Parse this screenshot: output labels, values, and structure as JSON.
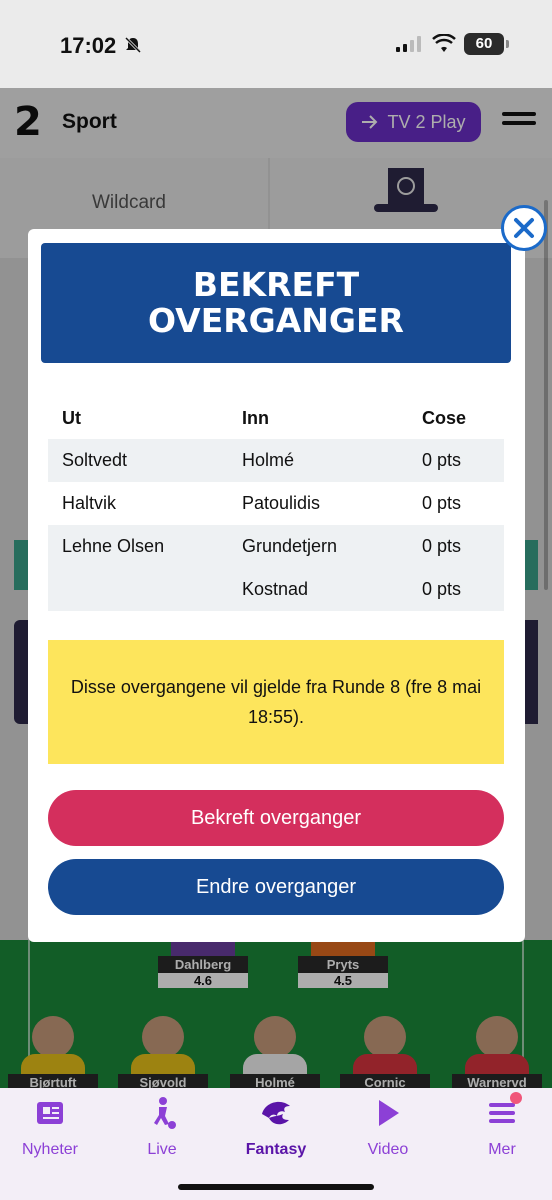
{
  "status_bar": {
    "time": "17:02",
    "battery": "60"
  },
  "header": {
    "brand_number": "2",
    "brand_name": "Sport",
    "play_button": "TV 2 Play"
  },
  "background": {
    "wildcard_label": "Wildcard",
    "pitch_players": [
      {
        "name": "Dahlberg",
        "value": "4.6"
      },
      {
        "name": "Pryts",
        "value": "4.5"
      },
      {
        "name": "Bjørtuft"
      },
      {
        "name": "Sjøvold"
      },
      {
        "name": "Holmé"
      },
      {
        "name": "Cornic"
      },
      {
        "name": "Warnervd"
      }
    ]
  },
  "modal": {
    "title": "BEKREFT OVERGANGER",
    "columns": [
      "Ut",
      "Inn",
      "Cose"
    ],
    "rows": [
      {
        "out": "Soltvedt",
        "in": "Holmé",
        "cost": "0 pts"
      },
      {
        "out": "Haltvik",
        "in": "Patoulidis",
        "cost": "0 pts"
      },
      {
        "out": "Lehne Olsen",
        "in": "Grundetjern",
        "cost": "0 pts"
      },
      {
        "out": "",
        "in": "Kostnad",
        "cost": "0 pts"
      }
    ],
    "notice": "Disse overgangene vil gjelde fra Runde 8 (fre 8 mai 18:55).",
    "confirm_button": "Bekreft overganger",
    "edit_button": "Endre overganger"
  },
  "tabbar": {
    "items": [
      {
        "label": "Nyheter",
        "icon": "newspaper-icon"
      },
      {
        "label": "Live",
        "icon": "football-player-icon"
      },
      {
        "label": "Fantasy",
        "icon": "fantasy-lion-icon",
        "active": true
      },
      {
        "label": "Video",
        "icon": "play-icon"
      },
      {
        "label": "Mer",
        "icon": "menu-icon"
      }
    ]
  },
  "colors": {
    "accent_purple": "#6b2fc7",
    "modal_blue": "#174a92",
    "confirm_red": "#d42f5d",
    "notice_yellow": "#fde55c"
  }
}
